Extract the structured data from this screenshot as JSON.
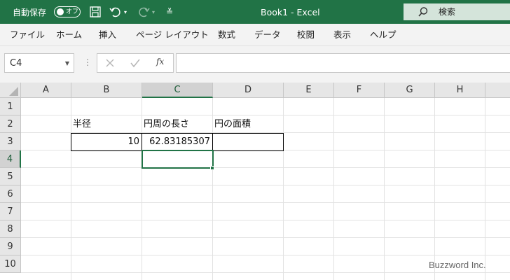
{
  "titlebar": {
    "autosave_label": "自動保存",
    "autosave_state": "オフ",
    "title": "Book1  -  Excel",
    "search_label": "検索",
    "accent_color": "#217346"
  },
  "ribbon": {
    "tabs": [
      "ファイル",
      "ホーム",
      "挿入",
      "ページ レイアウト",
      "数式",
      "データ",
      "校閲",
      "表示",
      "ヘルプ"
    ]
  },
  "formula_bar": {
    "name_box": "C4",
    "fx_label": "fx",
    "formula": ""
  },
  "sheet": {
    "columns": [
      "A",
      "B",
      "C",
      "D",
      "E",
      "F",
      "G",
      "H"
    ],
    "rows": [
      "1",
      "2",
      "3",
      "4",
      "5",
      "6",
      "7",
      "8",
      "9",
      "10"
    ],
    "selected_cell": "C4",
    "cells": {
      "B2": "半径",
      "C2": "円周の長さ",
      "D2": "円の面積",
      "B3": "10",
      "C3": "62.83185307",
      "D3": ""
    }
  },
  "watermark": "Buzzword Inc."
}
